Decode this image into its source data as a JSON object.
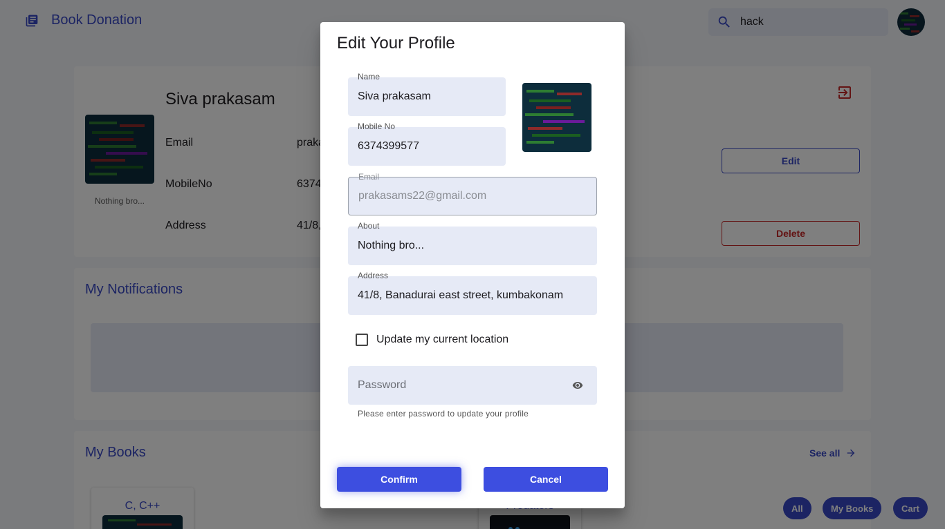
{
  "app": {
    "brand_title": "Book Donation",
    "search_value": "hack"
  },
  "profile": {
    "name": "Siva prakasam",
    "about": "Nothing bro...",
    "rows": [
      {
        "label": "Email",
        "value": "praka"
      },
      {
        "label": "MobileNo",
        "value": "6374"
      },
      {
        "label": "Address",
        "value": "41/8,"
      }
    ],
    "edit_label": "Edit",
    "delete_label": "Delete"
  },
  "notifications": {
    "title": "My Notifications"
  },
  "books": {
    "title": "My Books",
    "see_all": "See all",
    "items": [
      {
        "title": "C, C++"
      },
      {
        "title": "Predators"
      }
    ]
  },
  "fabs": {
    "all": "All",
    "my_books": "My Books",
    "cart": "Cart"
  },
  "dialog": {
    "title": "Edit Your Profile",
    "name_label": "Name",
    "name_value": "Siva prakasam",
    "mobile_label": "Mobile No",
    "mobile_value": "6374399577",
    "email_label": "Email",
    "email_value": "prakasams22@gmail.com",
    "about_label": "About",
    "about_value": "Nothing bro...",
    "address_label": "Address",
    "address_value": "41/8, Banadurai east street, kumbakonam",
    "location_checkbox_label": "Update my current location",
    "password_placeholder": "Password",
    "password_helper": "Please enter password to update your profile",
    "confirm_label": "Confirm",
    "cancel_label": "Cancel"
  },
  "colors": {
    "primary": "#3949c6",
    "dialog_button": "#3d4ee0",
    "danger": "#c62828"
  }
}
